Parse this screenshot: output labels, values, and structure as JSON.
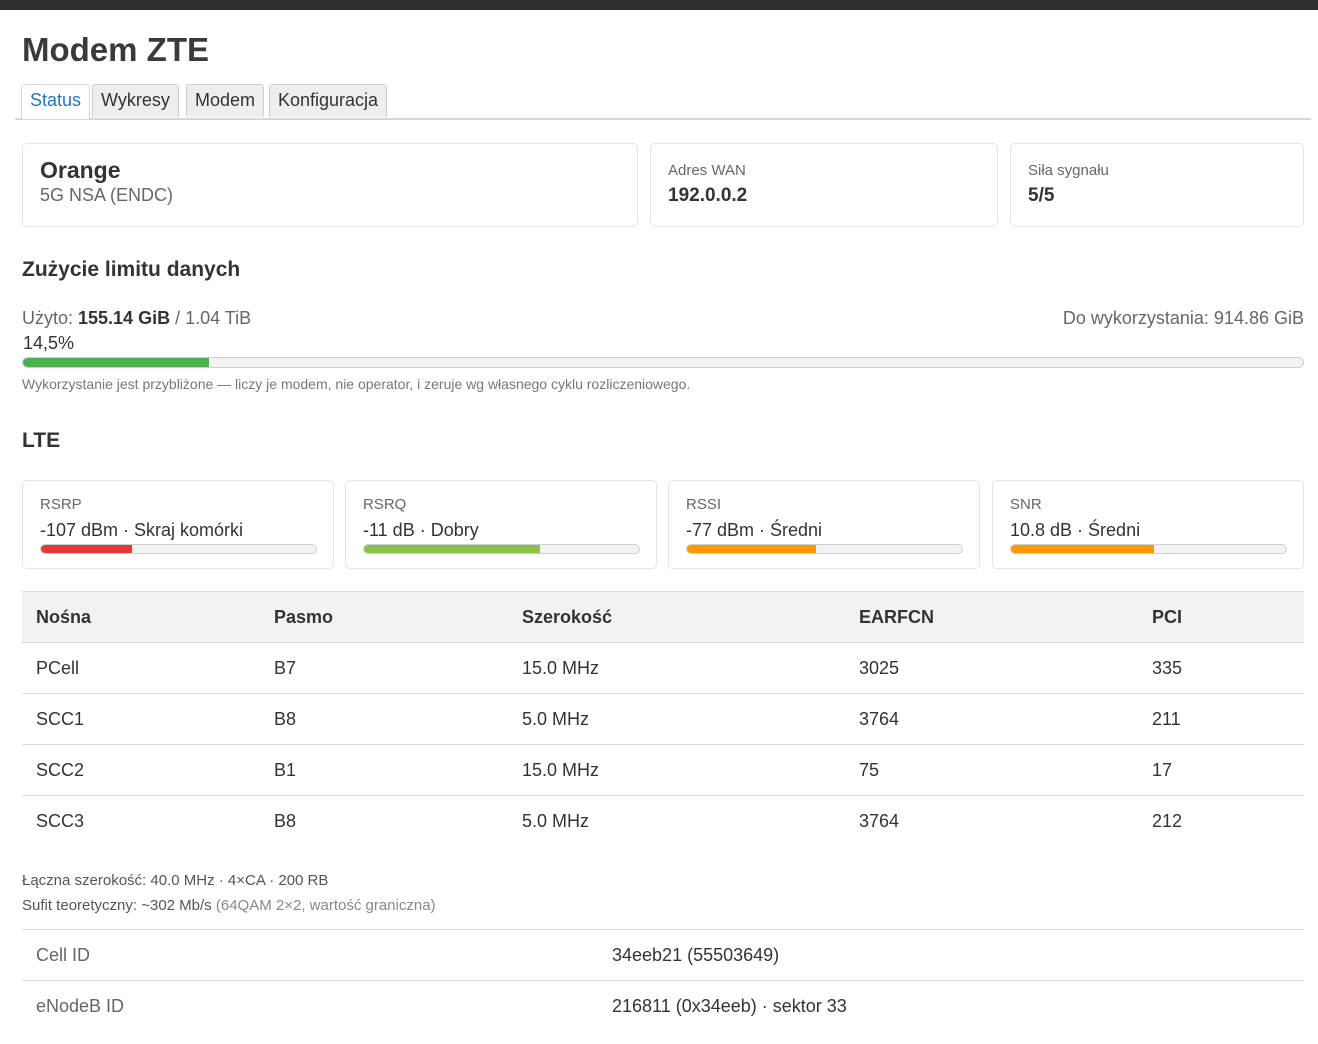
{
  "page": {
    "title": "Modem ZTE"
  },
  "tabs": [
    {
      "label": "Status",
      "active": true
    },
    {
      "label": "Wykresy",
      "active": false
    },
    {
      "label": "Modem",
      "active": false
    },
    {
      "label": "Konfiguracja",
      "active": false
    }
  ],
  "overview": {
    "operator": "Orange",
    "technology": "5G NSA (ENDC)",
    "wan_label": "Adres WAN",
    "wan_value": "192.0.0.2",
    "signal_label": "Siła sygnału",
    "signal_value": "5/5"
  },
  "usage": {
    "heading": "Zużycie limitu danych",
    "used_label": "Użyto: ",
    "used_value": "155.14 GiB",
    "total": " / 1.04 TiB",
    "remaining": "Do wykorzystania: 914.86 GiB",
    "percent_text": "14,5%",
    "percent_value": 14.5,
    "bar_color": "#4caf50",
    "note": "Wykorzystanie jest przybliżone — liczy je modem, nie operator, i zeruje wg własnego cyklu rozliczeniowego."
  },
  "lte": {
    "heading": "LTE",
    "metrics": [
      {
        "label": "RSRP",
        "value": "-107 dBm · Skraj komórki",
        "level": 33,
        "color": "#e53935"
      },
      {
        "label": "RSRQ",
        "value": "-11 dB · Dobry",
        "level": 64,
        "color": "#8bc34a"
      },
      {
        "label": "RSSI",
        "value": "-77 dBm · Średni",
        "level": 47,
        "color": "#ff9800"
      },
      {
        "label": "SNR",
        "value": "10.8 dB · Średni",
        "level": 52,
        "color": "#ff9800"
      }
    ]
  },
  "carriers": {
    "headers": [
      "Nośna",
      "Pasmo",
      "Szerokość",
      "EARFCN",
      "PCI"
    ],
    "rows": [
      [
        "PCell",
        "B7",
        "15.0 MHz",
        "3025",
        "335"
      ],
      [
        "SCC1",
        "B8",
        "5.0 MHz",
        "3764",
        "211"
      ],
      [
        "SCC2",
        "B1",
        "15.0 MHz",
        "75",
        "17"
      ],
      [
        "SCC3",
        "B8",
        "5.0 MHz",
        "3764",
        "212"
      ]
    ]
  },
  "summary": {
    "line1": "Łączna szerokość: 40.0 MHz · 4×CA · 200 RB",
    "line2_main": "Sufit teoretyczny: ~302 Mb/s",
    "line2_muted": " (64QAM 2×2, wartość graniczna)"
  },
  "cell_info": {
    "rows": [
      [
        "Cell ID",
        "34eeb21 (55503649)"
      ],
      [
        "eNodeB ID",
        "216811 (0x34eeb) · sektor 33"
      ]
    ]
  }
}
